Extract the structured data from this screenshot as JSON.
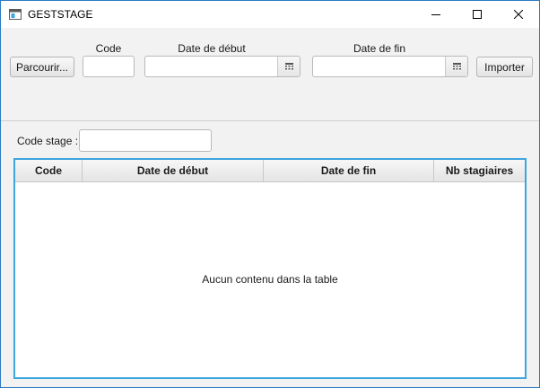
{
  "window": {
    "title": "GESTSTAGE",
    "controls": {
      "minimize": "minimize-icon",
      "maximize": "maximize-icon",
      "close": "close-icon"
    }
  },
  "import_bar": {
    "browse_label": "Parcourir...",
    "code_label": "Code",
    "code_value": "",
    "start_label": "Date de début",
    "start_value": "",
    "end_label": "Date de fin",
    "end_value": "",
    "calendar_icon": "calendar-icon",
    "import_label": "Importer"
  },
  "filter": {
    "label": "Code stage :",
    "value": ""
  },
  "table": {
    "columns": [
      "Code",
      "Date de début",
      "Date de fin",
      "Nb stagiaires"
    ],
    "rows": [],
    "empty_text": "Aucun contenu dans la table",
    "accent": "#3ea6dc"
  }
}
